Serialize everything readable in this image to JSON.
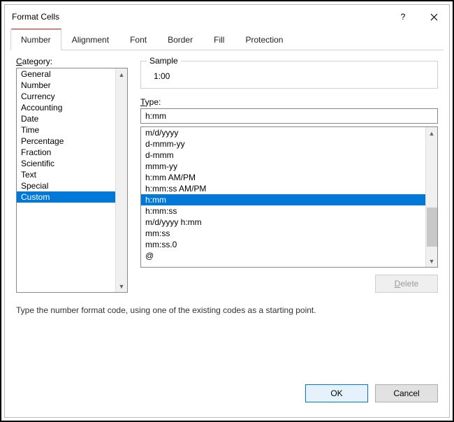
{
  "title": "Format Cells",
  "tabs": {
    "number": "Number",
    "alignment": "Alignment",
    "font": "Font",
    "border": "Border",
    "fill": "Fill",
    "protection": "Protection"
  },
  "category": {
    "label": "Category:",
    "items": [
      "General",
      "Number",
      "Currency",
      "Accounting",
      "Date",
      "Time",
      "Percentage",
      "Fraction",
      "Scientific",
      "Text",
      "Special",
      "Custom"
    ],
    "selected": "Custom"
  },
  "sample": {
    "label": "Sample",
    "value": "1:00"
  },
  "type": {
    "label": "Type:",
    "value": "h:mm",
    "options": [
      "m/d/yyyy",
      "d-mmm-yy",
      "d-mmm",
      "mmm-yy",
      "h:mm AM/PM",
      "h:mm:ss AM/PM",
      "h:mm",
      "h:mm:ss",
      "m/d/yyyy h:mm",
      "mm:ss",
      "mm:ss.0",
      "@"
    ],
    "selected": "h:mm"
  },
  "buttons": {
    "delete": "Delete",
    "ok": "OK",
    "cancel": "Cancel"
  },
  "hint": "Type the number format code, using one of the existing codes as a starting point."
}
